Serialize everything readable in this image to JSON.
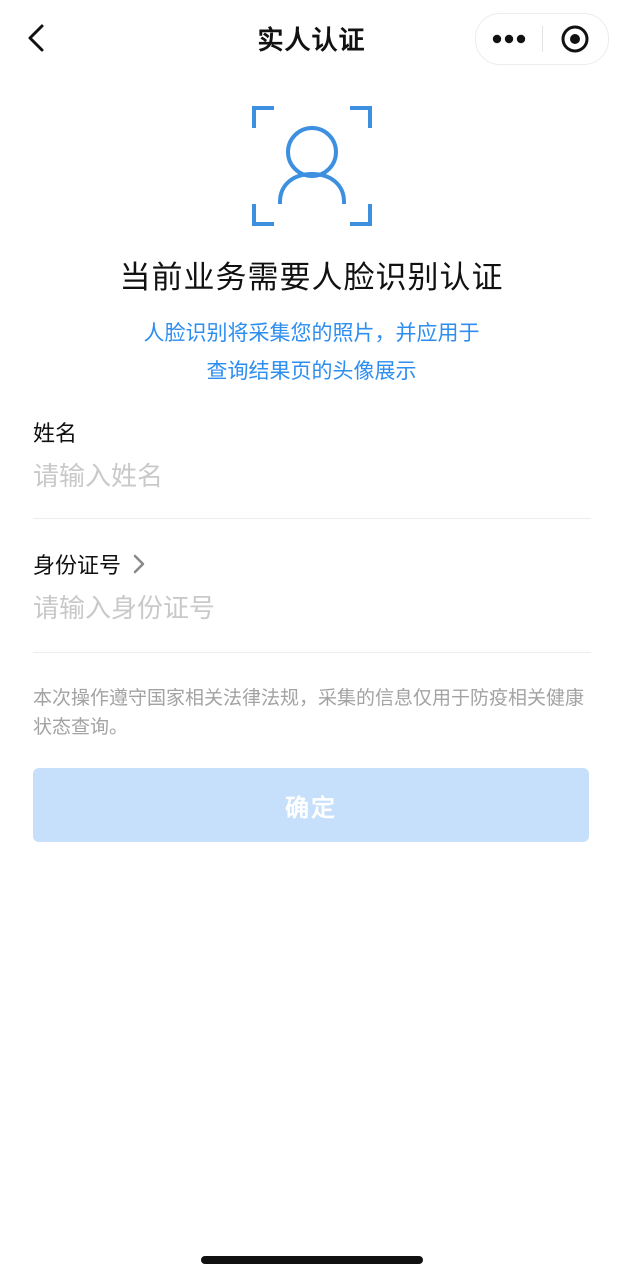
{
  "nav": {
    "title": "实人认证",
    "back_icon": "chevron-left-icon",
    "more_icon": "more-dots-icon",
    "close_icon": "target-circle-icon"
  },
  "hero": {
    "icon": "face-scan-icon",
    "title": "当前业务需要人脸识别认证",
    "desc_line1": "人脸识别将采集您的照片，并应用于",
    "desc_line2": "查询结果页的头像展示"
  },
  "form": {
    "name": {
      "label": "姓名",
      "value": "",
      "placeholder": "请输入姓名"
    },
    "id": {
      "label": "身份证号",
      "value": "",
      "placeholder": "请输入身份证号",
      "icon": "chevron-right-icon"
    }
  },
  "notice": "本次操作遵守国家相关法律法规，采集的信息仅用于防疫相关健康状态查询。",
  "confirm_label": "确定",
  "colors": {
    "accent": "#2d8ef0",
    "icon_blue": "#3d8fe0",
    "button_disabled_bg": "#c6dffa",
    "placeholder": "#c9c9c9",
    "notice_text": "#a3a3a3",
    "separator": "#ececec"
  }
}
